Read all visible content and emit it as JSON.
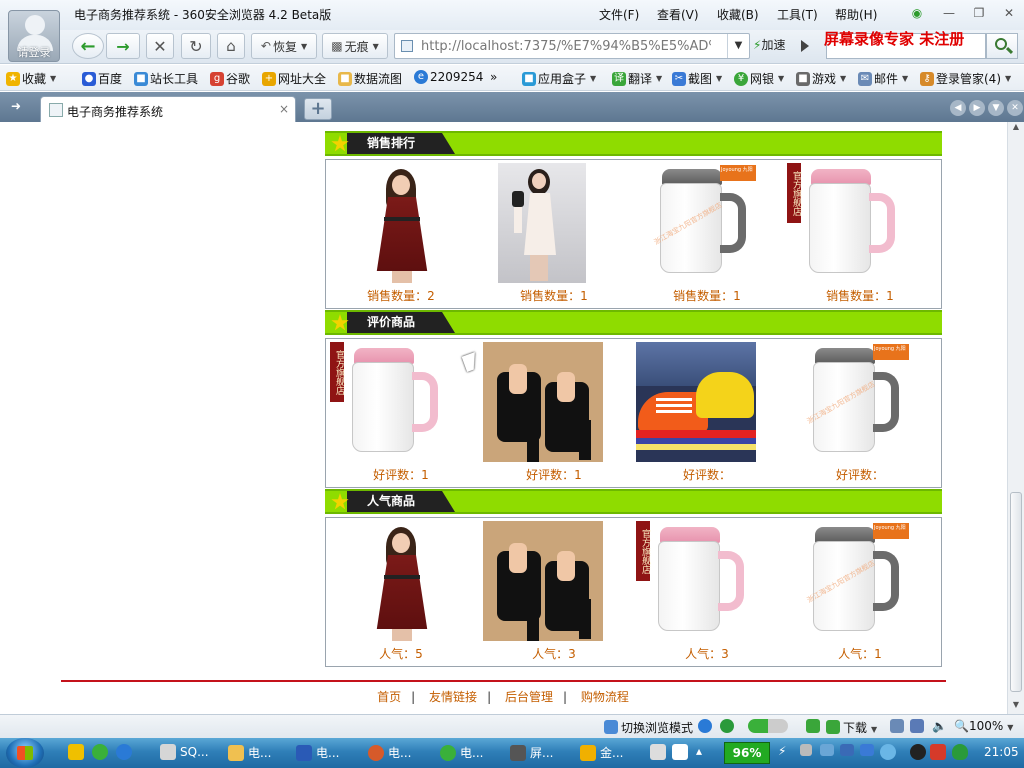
{
  "window": {
    "title": "电子商务推荐系统 - 360安全浏览器 4.2 Beta版",
    "login_label": "请登录",
    "menu": [
      "文件(F)",
      "查看(V)",
      "收藏(B)",
      "工具(T)",
      "帮助(H)"
    ]
  },
  "nav": {
    "back_label": "",
    "restore_label": "恢复",
    "incognito_label": "无痕",
    "url": "http://localhost:7375/%E7%94%B5%E5%AD%90",
    "speedup_label": "加速",
    "watermark": "屏幕录像专家  未注册"
  },
  "bookmarks": [
    {
      "label": "收藏",
      "icon": "star-icon",
      "color": "#f0b400"
    },
    {
      "label": "百度",
      "icon": "baidu-icon",
      "color": "#2a5cd6"
    },
    {
      "label": "站长工具",
      "icon": "tool-icon",
      "color": "#3a8ad6"
    },
    {
      "label": "谷歌",
      "icon": "google-icon",
      "color": "#d64232"
    },
    {
      "label": "网址大全",
      "icon": "plus-icon",
      "color": "#e8a600"
    },
    {
      "label": "数据流图",
      "icon": "folder-icon",
      "color": "#e8b84a"
    },
    {
      "label": "2209254",
      "icon": "ie-icon",
      "color": "#2a7ad6"
    },
    {
      "label": "»",
      "icon": "more-icon",
      "color": ""
    },
    {
      "label": "应用盒子",
      "icon": "box-icon",
      "color": "#2a9ad6"
    },
    {
      "label": "翻译",
      "icon": "translate-icon",
      "color": "#3aa63a"
    },
    {
      "label": "截图",
      "icon": "screenshot-icon",
      "color": "#3a7ad6"
    },
    {
      "label": "网银",
      "icon": "bank-icon",
      "color": "#3aa63a"
    },
    {
      "label": "游戏",
      "icon": "game-icon",
      "color": "#6a6a6a"
    },
    {
      "label": "邮件",
      "icon": "mail-icon",
      "color": "#6a8ab6"
    },
    {
      "label": "登录管家(4)",
      "icon": "key-icon",
      "color": "#d68a2a"
    }
  ],
  "tab": {
    "title": "电子商务推荐系统",
    "close": "×",
    "new_tab": "+"
  },
  "sections": [
    {
      "title": "销售排行",
      "items": [
        {
          "caption": "销售数量：2",
          "image": "red-dress"
        },
        {
          "caption": "销售数量：1",
          "image": "white-dress"
        },
        {
          "caption": "销售数量：1",
          "image": "grey-kettle"
        },
        {
          "caption": "销售数量：1",
          "image": "pink-kettle-badge"
        }
      ]
    },
    {
      "title": "评价商品",
      "items": [
        {
          "caption": "好评数：1",
          "image": "pink-kettle-badge"
        },
        {
          "caption": "好评数：1",
          "image": "black-sandals"
        },
        {
          "caption": "好评数：",
          "image": "sneaker"
        },
        {
          "caption": "好评数：",
          "image": "grey-kettle"
        }
      ]
    },
    {
      "title": "人气商品",
      "items": [
        {
          "caption": "人气：5",
          "image": "red-dress"
        },
        {
          "caption": "人气：3",
          "image": "black-sandals"
        },
        {
          "caption": "人气：3",
          "image": "pink-kettle-badge"
        },
        {
          "caption": "人气：1",
          "image": "grey-kettle"
        }
      ]
    }
  ],
  "product_text": {
    "kettle_brand": "Joyoung 九阳",
    "kettle_badge": "官方旗舰店",
    "kettle_watermark": "浙江海宝九阳官方旗舰店"
  },
  "footer": {
    "links": [
      "首页",
      "友情链接",
      "后台管理",
      "购物流程"
    ]
  },
  "statusbar": {
    "switch_mode": "切换浏览模式",
    "download": "下载",
    "zoom": "100%"
  },
  "taskbar": {
    "items": [
      "SQ...",
      "电...",
      "电...",
      "电...",
      "电...",
      "屏...",
      "金..."
    ],
    "cpu": "96%",
    "clock": "21:05"
  },
  "colors": {
    "section_green": "#8fdc00",
    "caption_orange": "#c45e00",
    "footer_red": "#c4121b",
    "watermark_red": "#e00000"
  }
}
